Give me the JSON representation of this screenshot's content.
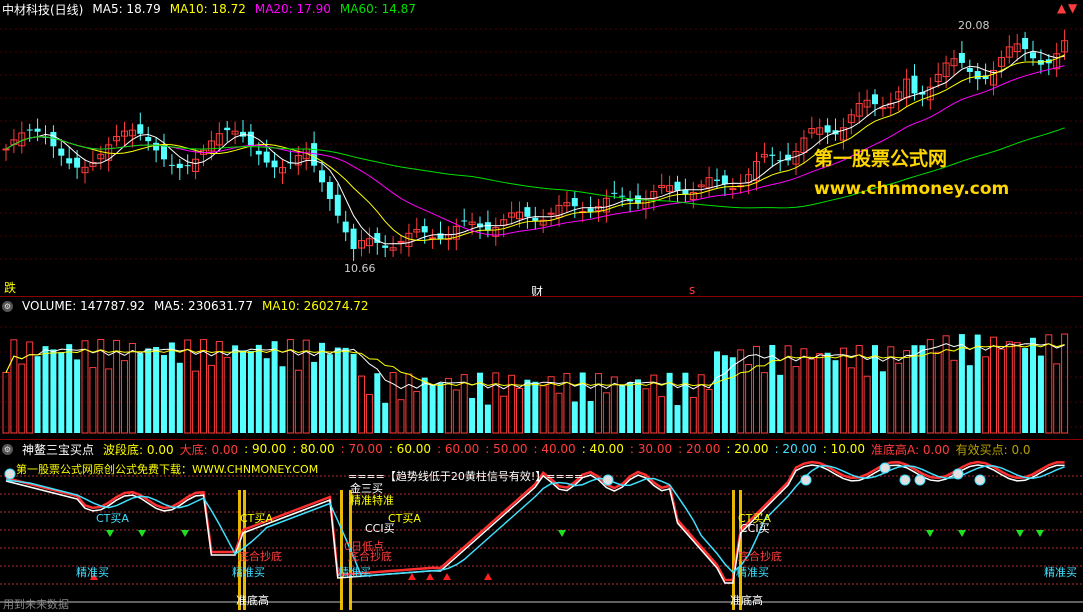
{
  "price": {
    "stock_name": "中材科技(日线)",
    "ma5": "MA5: 18.79",
    "ma10": "MA10: 18.72",
    "ma20": "MA20: 17.90",
    "ma60": "MA60: 14.87",
    "high_label": "20.08",
    "low_label": "10.66",
    "marker_die": "跌",
    "marker_cai": "财",
    "marker_s": "s",
    "watermark1": "第一股票公式网",
    "watermark2": "www.chnmoney.com",
    "corner_up": "▲",
    "corner_down": "▼"
  },
  "volume": {
    "vol": "VOLUME: 147787.92",
    "ma5": "MA5: 230631.77",
    "ma10": "MA10: 260274.72"
  },
  "indicator": {
    "name": "神鳌三宝买点",
    "params": [
      {
        "text": "波段底: 0.00",
        "color": "#ffff00"
      },
      {
        "text": "大底: 0.00",
        "color": "#ff3c3c"
      },
      {
        "text": ": 90.00",
        "color": "#ffff00"
      },
      {
        "text": ": 80.00",
        "color": "#ffff00"
      },
      {
        "text": ": 70.00",
        "color": "#ff3c3c"
      },
      {
        "text": ": 60.00",
        "color": "#ffff00"
      },
      {
        "text": ": 60.00",
        "color": "#ff3c3c"
      },
      {
        "text": ": 50.00",
        "color": "#ff3c3c"
      },
      {
        "text": ": 40.00",
        "color": "#ff3c3c"
      },
      {
        "text": ": 40.00",
        "color": "#ffff00"
      },
      {
        "text": ": 30.00",
        "color": "#ff3c3c"
      },
      {
        "text": ": 20.00",
        "color": "#ff3c3c"
      },
      {
        "text": ": 20.00",
        "color": "#ffff00"
      },
      {
        "text": ": 20.00",
        "color": "#40e0ff"
      },
      {
        "text": ": 10.00",
        "color": "#ffff00"
      },
      {
        "text": "准底高A: 0.00",
        "color": "#ff3c3c"
      },
      {
        "text": "有效买点: 0.0",
        "color": "#b8a000"
      }
    ],
    "banner_left": "第一股票公式网原创公式免费下载：WWW.CHNMONEY.COM",
    "banner_right": "====【趋势线低于20黄柱信号有效!】====",
    "labels": {
      "ct_buy": "CT买A",
      "zhunque_buy": "精准买",
      "zhunque_di": "准底高",
      "qudi_chaodi": "底合抄底",
      "zhangsan": "金三买",
      "jingzhun": "精准特准",
      "ccj_buy": "CCI买",
      "zddi": "0日低点",
      "bottom_text": "用到未来数据"
    }
  },
  "colors": {
    "up": "#ff3c3c",
    "down": "#54ffff",
    "ma5": "#ffffff",
    "ma10": "#ffff00",
    "ma20": "#ff00ff",
    "ma60": "#00e000",
    "grid": "#8b0000"
  }
}
